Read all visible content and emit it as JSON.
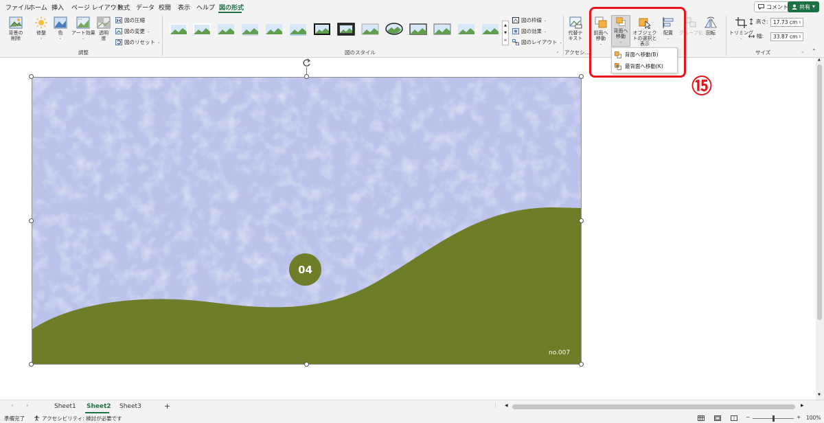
{
  "menu": {
    "tabs": [
      "ファイル",
      "ホーム",
      "挿入",
      "ページ レイアウト",
      "数式",
      "データ",
      "校閲",
      "表示",
      "ヘルプ",
      "図の形式"
    ],
    "active_tab": "図の形式",
    "comment_button": "コメント",
    "share_button": "共有"
  },
  "ribbon": {
    "adjust": {
      "remove_bg": "背景の削除",
      "corrections": "修整",
      "color": "色",
      "artistic": "アート効果",
      "transparency": "透明度",
      "compress": "図の圧縮",
      "change": "図の変更",
      "reset": "図のリセット",
      "group_label": "調整"
    },
    "styles": {
      "border": "図の枠線",
      "effects": "図の効果",
      "layout": "図のレイアウト",
      "group_label": "図のスタイル"
    },
    "accessibility": {
      "alt_text": "代替テキスト",
      "group_label": "アクセシ..."
    },
    "arrange": {
      "bring_forward": "前面へ移動",
      "send_backward": "背面へ移動",
      "selection_pane": "オブジェクトの選択と表示",
      "align": "配置",
      "group": "グループ化",
      "rotate": "回転"
    },
    "size": {
      "crop": "トリミング",
      "height_label": "高さ:",
      "height_value": "17.73 cm",
      "width_label": "幅:",
      "width_value": "33.87 cm",
      "group_label": "サイズ"
    }
  },
  "dropdown": {
    "items": [
      "背面へ移動(B)",
      "最背面へ移動(K)"
    ]
  },
  "annotation": {
    "step_number": "⑮",
    "color": "#e8141c"
  },
  "picture": {
    "badge_text": "04",
    "label": "no.007",
    "sky_color": "#bcc3eb",
    "hill_color": "#6e7d28"
  },
  "sheets": {
    "tabs": [
      "Sheet1",
      "Sheet2",
      "Sheet3"
    ],
    "active": "Sheet2",
    "add": "+"
  },
  "status": {
    "ready": "準備完了",
    "accessibility": "アクセシビリティ: 検討が必要です",
    "zoom": "100%"
  }
}
